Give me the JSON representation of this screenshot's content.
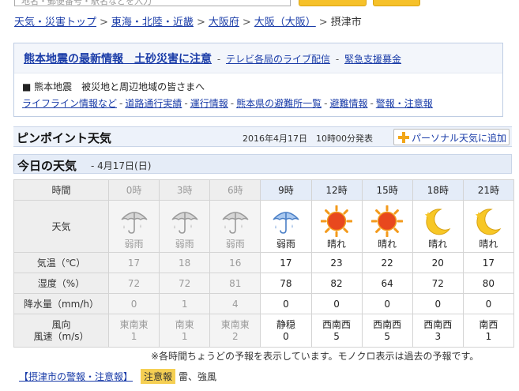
{
  "top": {
    "search_placeholder": "地名・郵便番号・駅名などを入力"
  },
  "breadcrumb": {
    "items": [
      "天気・災害トップ",
      "東海・北陸・近畿",
      "大阪府",
      "大阪（大阪）"
    ],
    "current": "摂津市",
    "separator": ">"
  },
  "notice": {
    "headline": "熊本地震の最新情報　土砂災害に注意",
    "head_links": [
      "テレビ各局のライブ配信",
      "緊急支援募金"
    ],
    "dash": "-",
    "body_title": "■ 熊本地震　被災地と周辺地域の皆さまへ",
    "body_links": [
      "ライフライン情報など",
      "道路通行実績",
      "運行情報",
      "熊本県の避難所一覧",
      "避難情報",
      "警報・注意報"
    ]
  },
  "pinpoint": {
    "title": "ピンポイント天気",
    "issued": "2016年4月17日　10時00分発表",
    "personal_button": "パーソナル天気に追加"
  },
  "today": {
    "title": "今日の天気",
    "date": "- 4月17日(日)"
  },
  "forecast": {
    "row_labels": {
      "time": "時間",
      "weather": "天気",
      "temp": "気温（℃）",
      "humidity": "湿度（%）",
      "rain": "降水量（mm/h）",
      "wind_dir": "風向",
      "wind_speed": "風速（m/s）"
    },
    "hours": [
      {
        "time": "0時",
        "past": true,
        "icon": "umbrella-rain-icon",
        "weather": "弱雨",
        "temp": "17",
        "humidity": "72",
        "rain": "0",
        "wind_dir": "東南東",
        "wind_speed": "1"
      },
      {
        "time": "3時",
        "past": true,
        "icon": "umbrella-rain-icon",
        "weather": "弱雨",
        "temp": "18",
        "humidity": "72",
        "rain": "1",
        "wind_dir": "南東",
        "wind_speed": "1"
      },
      {
        "time": "6時",
        "past": true,
        "icon": "umbrella-rain-icon",
        "weather": "弱雨",
        "temp": "16",
        "humidity": "81",
        "rain": "4",
        "wind_dir": "東南東",
        "wind_speed": "2"
      },
      {
        "time": "9時",
        "past": false,
        "icon": "umbrella-rain-icon",
        "weather": "弱雨",
        "temp": "17",
        "humidity": "78",
        "rain": "0",
        "wind_dir": "静穏",
        "wind_speed": "0"
      },
      {
        "time": "12時",
        "past": false,
        "icon": "sun-icon",
        "weather": "晴れ",
        "temp": "23",
        "humidity": "82",
        "rain": "0",
        "wind_dir": "西南西",
        "wind_speed": "5"
      },
      {
        "time": "15時",
        "past": false,
        "icon": "sun-icon",
        "weather": "晴れ",
        "temp": "22",
        "humidity": "64",
        "rain": "0",
        "wind_dir": "西南西",
        "wind_speed": "5"
      },
      {
        "time": "18時",
        "past": false,
        "icon": "moon-icon",
        "weather": "晴れ",
        "temp": "20",
        "humidity": "72",
        "rain": "0",
        "wind_dir": "西南西",
        "wind_speed": "3"
      },
      {
        "time": "21時",
        "past": false,
        "icon": "moon-icon",
        "weather": "晴れ",
        "temp": "17",
        "humidity": "80",
        "rain": "0",
        "wind_dir": "南西",
        "wind_speed": "1"
      }
    ]
  },
  "note": "※各時間ちょうどの予報を表示しています。モノクロ表示は過去の予報です。",
  "warning": {
    "link": "【摂津市の警報・注意報】",
    "badge": "注意報",
    "text": "雷、強風"
  },
  "colors": {
    "link": "#1a3ca8",
    "accent_yellow": "#f6c12a",
    "header_blue": "#e5ecf7"
  }
}
